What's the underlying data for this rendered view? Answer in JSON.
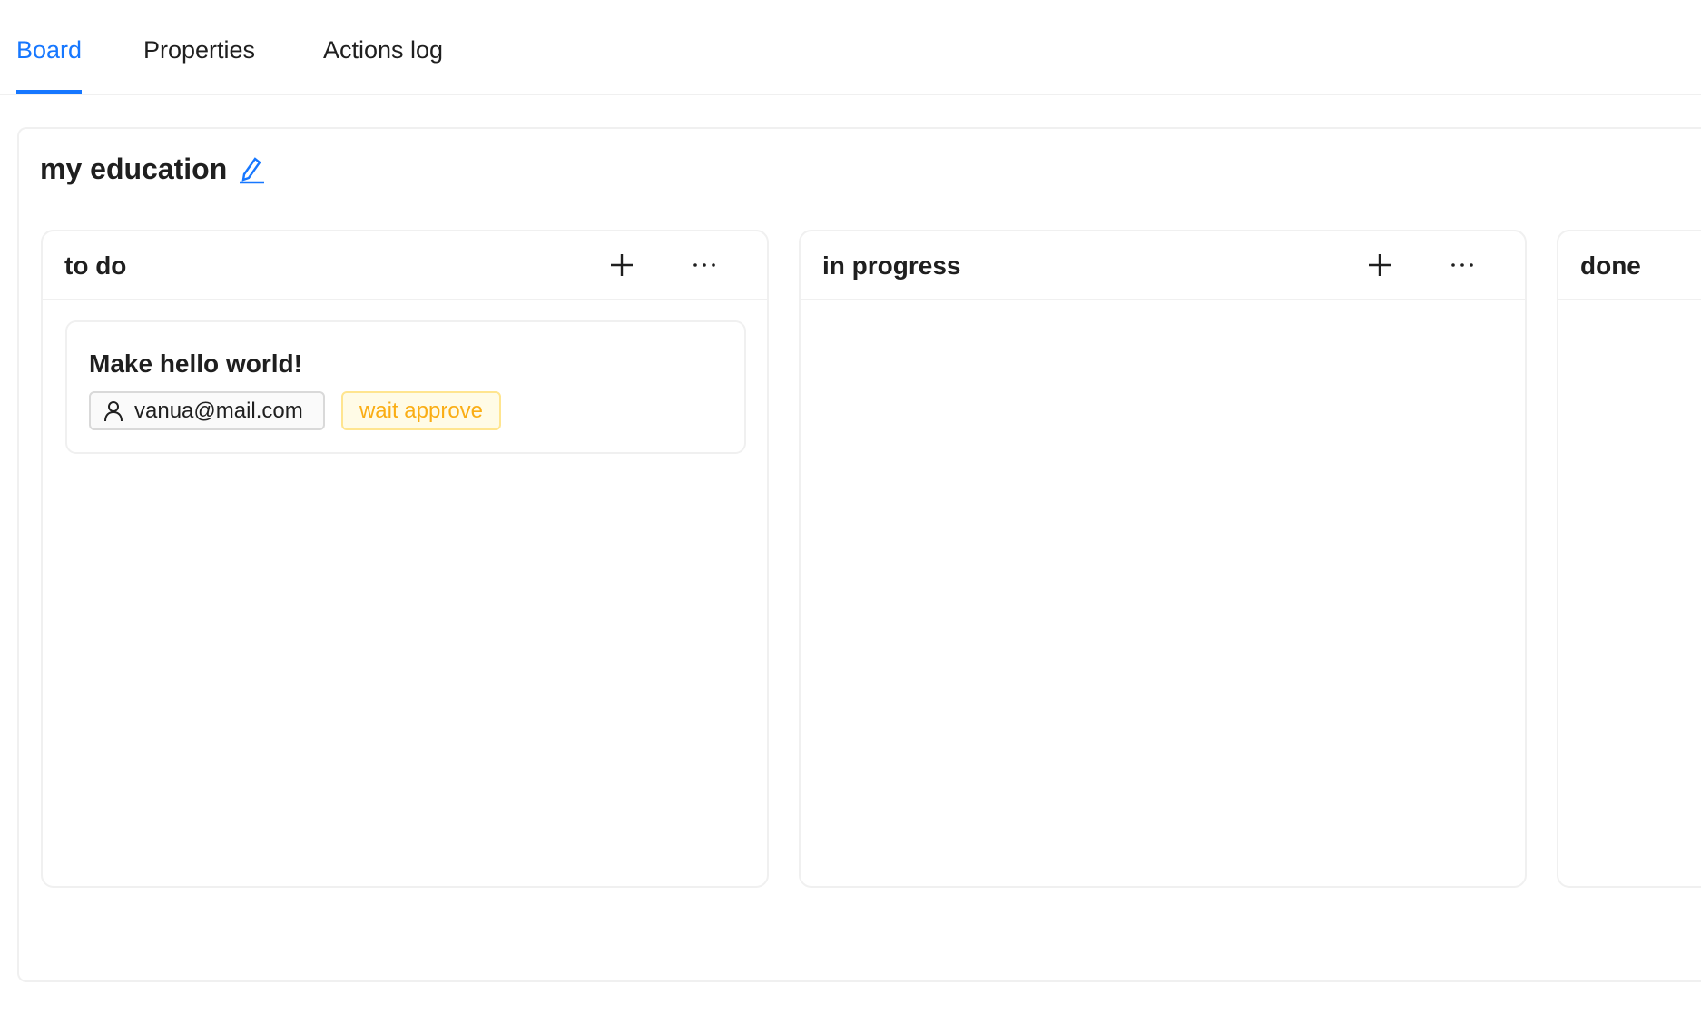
{
  "tabs": [
    {
      "label": "Board",
      "active": true
    },
    {
      "label": "Properties",
      "active": false
    },
    {
      "label": "Actions log",
      "active": false
    }
  ],
  "board": {
    "title": "my education",
    "edit_icon": "edit-pencil-icon"
  },
  "columns": [
    {
      "title": "to do",
      "cards": [
        {
          "title": "Make hello world!",
          "assignee": "vanua@mail.com",
          "status": "wait approve"
        }
      ]
    },
    {
      "title": "in progress",
      "cards": []
    },
    {
      "title": "done",
      "cards": []
    }
  ],
  "colors": {
    "accent": "#1677ff",
    "status_text": "#faad14",
    "status_bg": "#fffbe6",
    "status_border": "#ffe58f"
  }
}
